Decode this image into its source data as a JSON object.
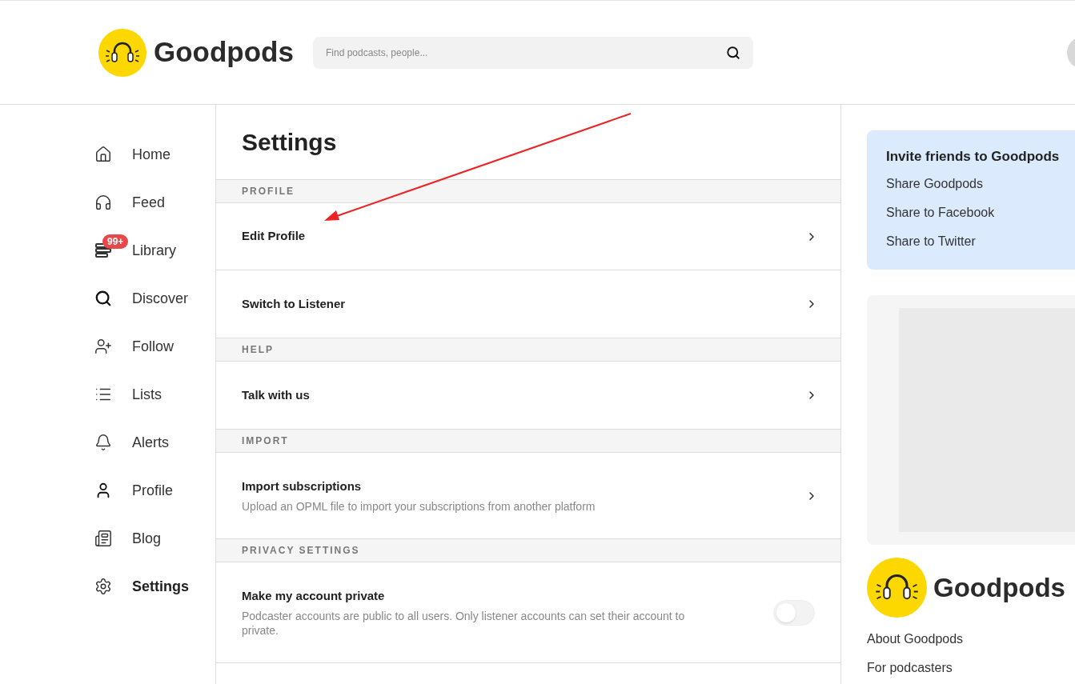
{
  "header": {
    "brand": "Goodpods",
    "search": {
      "placeholder": "Find podcasts, people..."
    }
  },
  "sidebar": {
    "items": [
      {
        "kind": "home",
        "label": "Home",
        "selected": false
      },
      {
        "kind": "feed",
        "label": "Feed",
        "selected": false
      },
      {
        "kind": "library",
        "label": "Library",
        "selected": false,
        "badge": "99+"
      },
      {
        "kind": "discover",
        "label": "Discover",
        "selected": false
      },
      {
        "kind": "follow",
        "label": "Follow",
        "selected": false
      },
      {
        "kind": "lists",
        "label": "Lists",
        "selected": false
      },
      {
        "kind": "alerts",
        "label": "Alerts",
        "selected": false
      },
      {
        "kind": "profile",
        "label": "Profile",
        "selected": false
      },
      {
        "kind": "blog",
        "label": "Blog",
        "selected": false
      },
      {
        "kind": "settings",
        "label": "Settings",
        "selected": true
      }
    ]
  },
  "main": {
    "title": "Settings",
    "sections": [
      {
        "heading": "PROFILE",
        "items": [
          {
            "kind": "link",
            "title": "Edit Profile"
          },
          {
            "kind": "link",
            "title": "Switch to Listener"
          }
        ]
      },
      {
        "heading": "HELP",
        "items": [
          {
            "kind": "link",
            "title": "Talk with us"
          }
        ]
      },
      {
        "heading": "IMPORT",
        "items": [
          {
            "kind": "link",
            "title": "Import subscriptions",
            "description": "Upload an OPML file to import your subscriptions from another platform"
          }
        ]
      },
      {
        "heading": "PRIVACY SETTINGS",
        "items": [
          {
            "kind": "toggle",
            "title": "Make my account private",
            "description": "Podcaster accounts are public to all users. Only listener accounts can set their account to private.",
            "on": false
          }
        ]
      }
    ]
  },
  "right": {
    "invite": {
      "title": "Invite friends to Goodpods",
      "links": [
        "Share Goodpods",
        "Share to Facebook",
        "Share to Twitter"
      ]
    },
    "footer": {
      "brand": "Goodpods",
      "links": [
        "About Goodpods",
        "For podcasters"
      ]
    }
  }
}
